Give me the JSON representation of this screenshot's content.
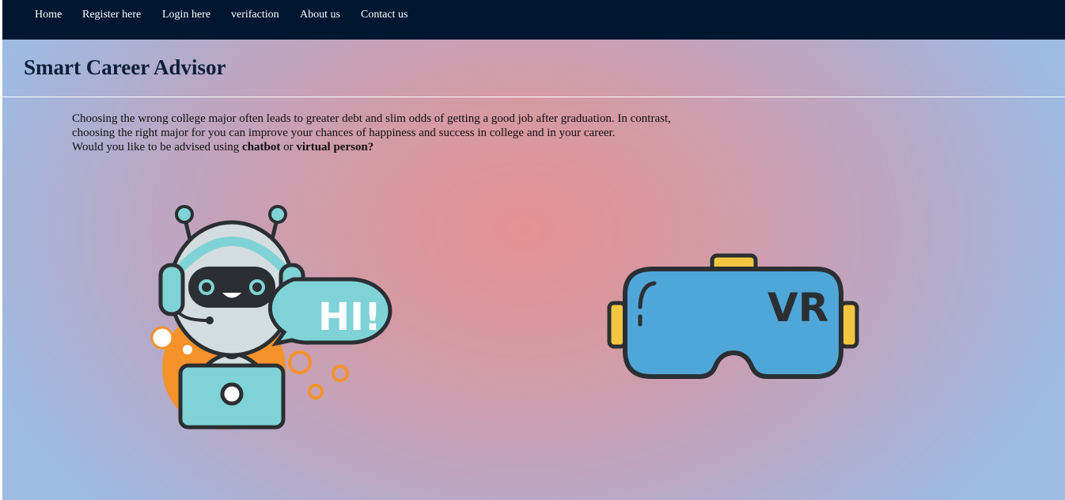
{
  "nav": {
    "items": [
      {
        "label": "Home"
      },
      {
        "label": "Register here"
      },
      {
        "label": "Login here"
      },
      {
        "label": "verifaction"
      },
      {
        "label": "About us"
      },
      {
        "label": "Contact us"
      }
    ]
  },
  "header": {
    "title": "Smart Career Advisor"
  },
  "intro": {
    "line1": "Choosing the wrong college major often leads to greater debt and slim odds of getting a good job after graduation. In contrast,",
    "line2": "choosing the right major for you can improve your chances of happiness and success in college and in your career.",
    "line3_prefix": "Would you like to be advised using ",
    "chatbot_word": "chatbot",
    "or_word": " or ",
    "virtual_person_word": "virtual person?"
  },
  "options": {
    "chatbot": {
      "icon": "chatbot-robot-icon",
      "bubble_text": "HI!"
    },
    "vr": {
      "icon": "vr-headset-icon",
      "headset_text": "VR"
    }
  },
  "colors": {
    "navbar": "#011731",
    "title": "#0d1f3a",
    "bg_center": "#e59192",
    "bg_edge": "#9dbbe3",
    "teal": "#7fd3d6",
    "orange": "#f5922a",
    "vr_blue": "#4fa6d8",
    "vr_yellow": "#f2c641",
    "outline": "#2b2f33"
  }
}
